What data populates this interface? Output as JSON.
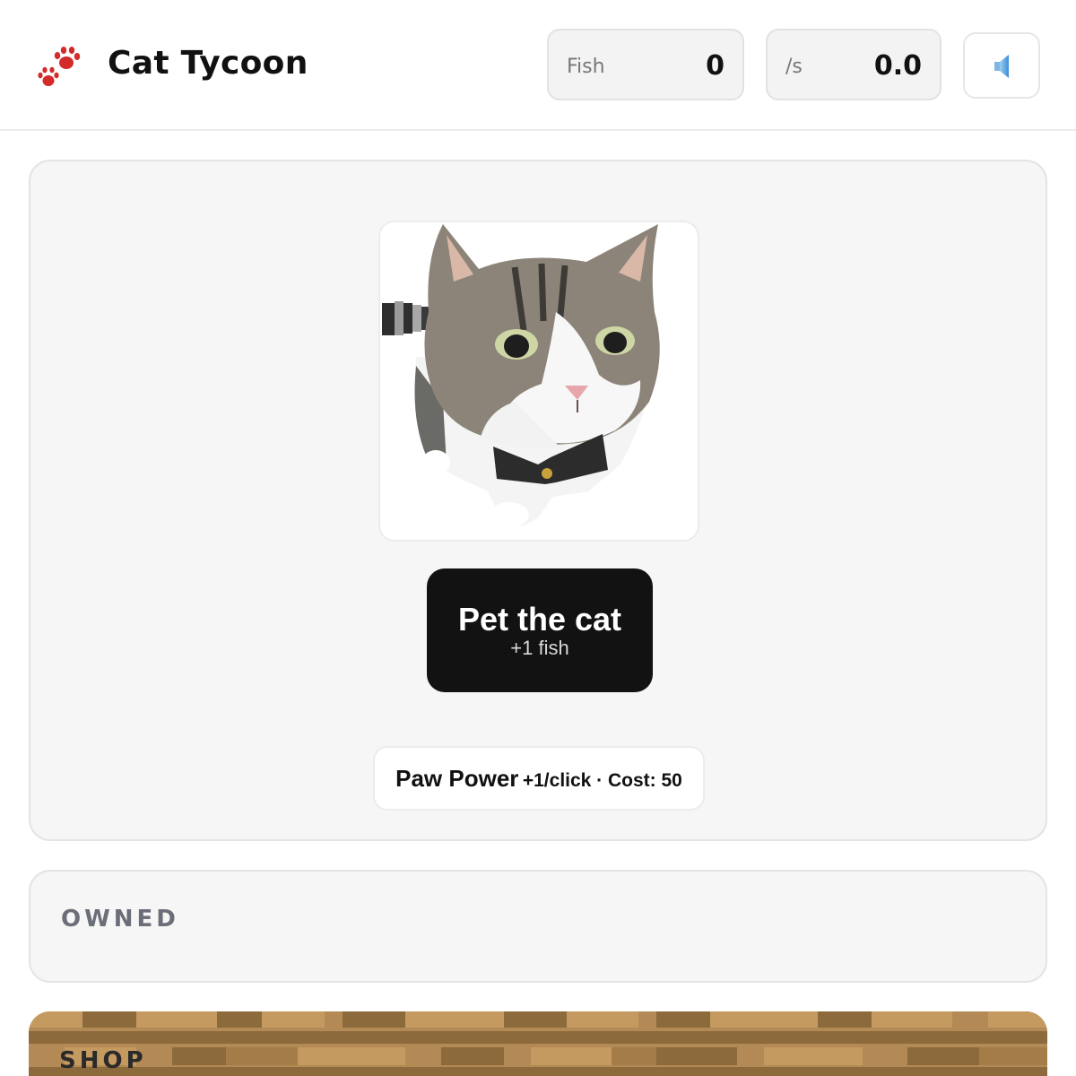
{
  "header": {
    "title": "Cat Tycoon",
    "logo_icon": "paw-prints-icon",
    "stats": {
      "fish_label": "Fish",
      "fish_value": "0",
      "rate_label": "/s",
      "rate_value": "0.0"
    },
    "sound_icon": "speaker-icon"
  },
  "main": {
    "cat_image": "cat-photo",
    "pet_button": {
      "label": "Pet the cat",
      "sublabel": "+1 fish"
    },
    "upgrade": {
      "name": "Paw Power",
      "detail": "+1/click · Cost: 50"
    }
  },
  "owned": {
    "title": "OWNED"
  },
  "shop": {
    "title": "SHOP"
  },
  "colors": {
    "accent": "#121212",
    "paw": "#d42a2a",
    "section_title": "#6b6e78",
    "shop_wood": "#b58c56"
  }
}
